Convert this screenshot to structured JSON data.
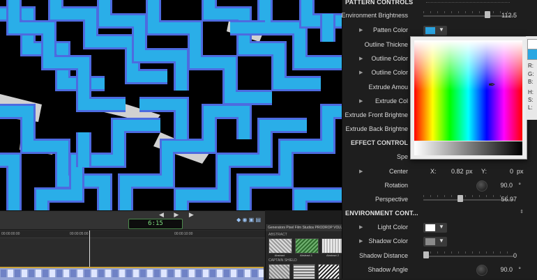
{
  "inspector": {
    "pattern_controls_header": "PATTERN CONTROLS",
    "environment_brightness": {
      "label": "Environment Brightness",
      "value": "112.5",
      "level": 0.72
    },
    "patten_color": {
      "label": "Patten Color",
      "swatch": "#2aa3df"
    },
    "outline_thickness": "Outline Thickne",
    "outline_color_1": "Outline Color",
    "outline_color_2": "Outline Color",
    "extrude_amount": "Extrude Amou",
    "extrude_color": "Extrude Col",
    "extrude_front_brightness": "Extrude Front Brightne",
    "extrude_back_brightness": "Extrude Back Brightne",
    "effect_controls_header": "EFFECT CONTROL",
    "speed": "Spe",
    "center": {
      "label": "Center",
      "x_label": "X:",
      "x_value": "0.82",
      "x_unit": "px",
      "y_label": "Y:",
      "y_value": "0",
      "y_unit": "px"
    },
    "rotation": {
      "label": "Rotation",
      "value": "90.0",
      "unit": "°"
    },
    "perspective": {
      "label": "Perspective",
      "value": "56.97",
      "level": 0.4
    },
    "environment_controls_header": "ENVIRONMENT CONT...",
    "light_color": {
      "label": "Light Color",
      "swatch": "#ffffff"
    },
    "shadow_color": {
      "label": "Shadow Color",
      "swatch": "#8a8a8a"
    },
    "shadow_distance": {
      "label": "Shadow Distance",
      "value": "0",
      "level": 0.0
    },
    "shadow_angle": {
      "label": "Shadow Angle",
      "value": "90.0",
      "unit": "°"
    },
    "dropdown_glyph": "▼",
    "disclosure_glyph": "▶",
    "stepper_glyph": "⇕"
  },
  "color_picker": {
    "labels": [
      "R:",
      "G:",
      "B:",
      "H:",
      "S:",
      "L:"
    ],
    "new_color": "#2aa7e2"
  },
  "timeline": {
    "timecode": "6:15",
    "play_glyphs": "◀ ▶ ▶",
    "ruler_marks": [
      "00:00:00:00",
      "00:00:05:00",
      "00:00:10:00"
    ],
    "icons": "◆ ◉ ▣ ▤"
  },
  "browser": {
    "header": "Generators  Pixel Film Studios  PRODROP VOLUME",
    "category_1": "ABSTRACT",
    "thumbs": [
      "Abstract",
      "Abstract 1",
      "Abstract 2"
    ],
    "category_2": "CAPTAIN SHIELD"
  },
  "colors": {
    "pattern_blue": "#2aaee8",
    "pattern_outline": "#4d6be0",
    "background": "#000000",
    "inspector_bg": "#1e1e1e"
  }
}
